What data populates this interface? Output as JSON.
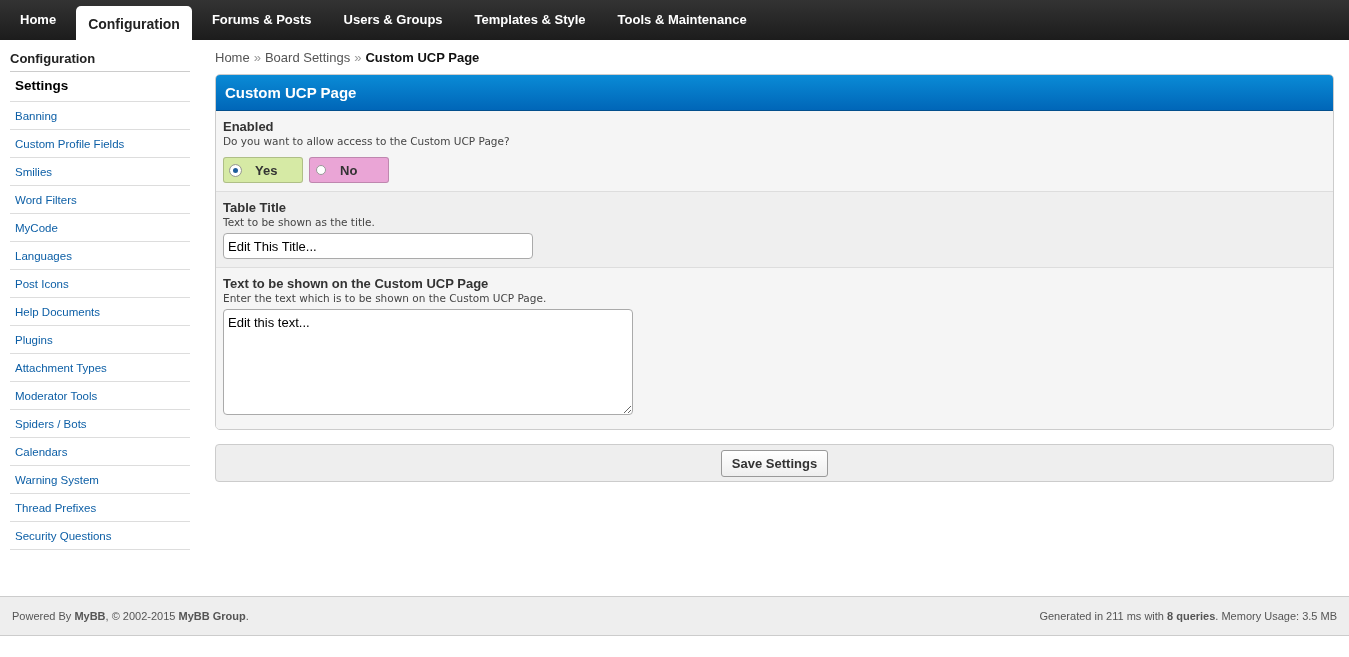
{
  "top_nav": [
    {
      "label": "Home",
      "selected": false
    },
    {
      "label": "Configuration",
      "selected": true
    },
    {
      "label": "Forums & Posts",
      "selected": false
    },
    {
      "label": "Users & Groups",
      "selected": false
    },
    {
      "label": "Templates & Style",
      "selected": false
    },
    {
      "label": "Tools & Maintenance",
      "selected": false
    }
  ],
  "sidebar": {
    "title": "Configuration",
    "items": [
      {
        "label": "Settings",
        "selected": true
      },
      {
        "label": "Banning",
        "selected": false
      },
      {
        "label": "Custom Profile Fields",
        "selected": false
      },
      {
        "label": "Smilies",
        "selected": false
      },
      {
        "label": "Word Filters",
        "selected": false
      },
      {
        "label": "MyCode",
        "selected": false
      },
      {
        "label": "Languages",
        "selected": false
      },
      {
        "label": "Post Icons",
        "selected": false
      },
      {
        "label": "Help Documents",
        "selected": false
      },
      {
        "label": "Plugins",
        "selected": false
      },
      {
        "label": "Attachment Types",
        "selected": false
      },
      {
        "label": "Moderator Tools",
        "selected": false
      },
      {
        "label": "Spiders / Bots",
        "selected": false
      },
      {
        "label": "Calendars",
        "selected": false
      },
      {
        "label": "Warning System",
        "selected": false
      },
      {
        "label": "Thread Prefixes",
        "selected": false
      },
      {
        "label": "Security Questions",
        "selected": false
      }
    ]
  },
  "breadcrumb": {
    "separator": "»",
    "items": [
      {
        "label": "Home",
        "current": false
      },
      {
        "label": "Board Settings",
        "current": false
      },
      {
        "label": "Custom UCP Page",
        "current": true
      }
    ]
  },
  "panel": {
    "title": "Custom UCP Page",
    "settings": [
      {
        "kind": "radio",
        "title": "Enabled",
        "description": "Do you want to allow access to the Custom UCP Page?",
        "options": [
          {
            "label": "Yes",
            "selected": true,
            "color": "#d6eaa5"
          },
          {
            "label": "No",
            "selected": false,
            "color": "#eaa5d6"
          }
        ]
      },
      {
        "kind": "text",
        "title": "Table Title",
        "description": "Text to be shown as the title.",
        "value": "Edit This Title..."
      },
      {
        "kind": "textarea",
        "title": "Text to be shown on the Custom UCP Page",
        "description": "Enter the text which is to be shown on the Custom UCP Page.",
        "value": "Edit this text..."
      }
    ]
  },
  "save_button": "Save Settings",
  "footer": {
    "left": "Powered By **MyBB**, © 2002-2015 **MyBB Group**.",
    "right": "Generated in 211 ms with **8 queries**. Memory Usage: 3.5 MB"
  }
}
